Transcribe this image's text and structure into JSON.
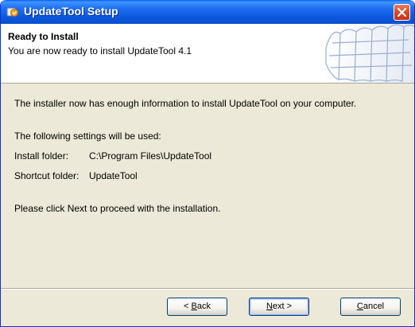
{
  "window": {
    "title": "UpdateTool Setup",
    "colors": {
      "titlebar": "#0B58DD",
      "face": "#ECE9D8",
      "close": "#D8431E"
    }
  },
  "header": {
    "title": "Ready to Install",
    "subtitle": "You are now ready to install UpdateTool 4.1"
  },
  "body": {
    "intro": "The installer now has enough information to install UpdateTool on your computer.",
    "settings_heading": "The following settings will be used:",
    "install_folder_label": "Install folder:",
    "install_folder_value": "C:\\Program Files\\UpdateTool",
    "shortcut_folder_label": "Shortcut folder:",
    "shortcut_folder_value": "UpdateTool",
    "instruction": "Please click Next to proceed with the installation."
  },
  "buttons": {
    "back": {
      "prefix": "< ",
      "mnemonic": "B",
      "rest": "ack"
    },
    "next": {
      "mnemonic": "N",
      "rest": "ext >"
    },
    "cancel": {
      "mnemonic": "C",
      "rest": "ancel"
    }
  },
  "icons": [
    "setup-app-icon",
    "close-icon",
    "header-decoration-image"
  ]
}
